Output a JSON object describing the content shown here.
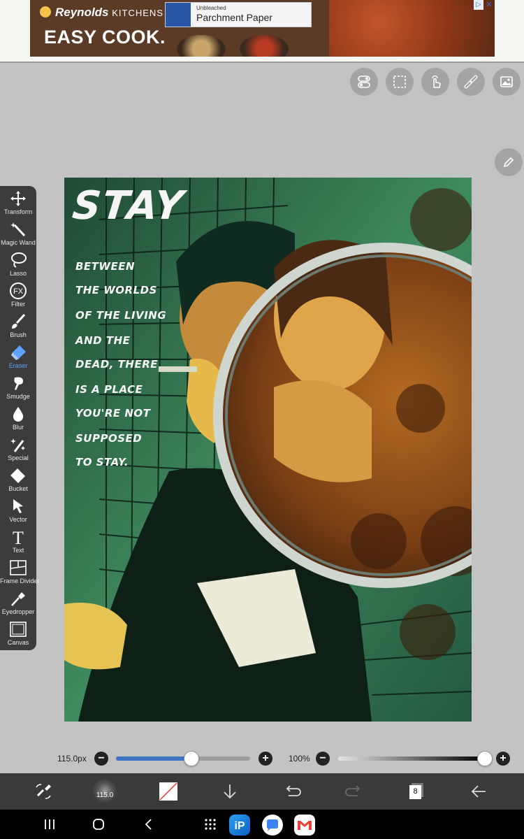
{
  "ad": {
    "brand": "Reynolds",
    "brand_suffix": "KITCHENS",
    "headline": "EASY COOK.",
    "product_sub": "Unbleached",
    "product_name": "Parchment Paper",
    "info_icon": "ad-info-icon",
    "close_icon": "ad-close-icon"
  },
  "top_buttons": [
    "toggle-icon",
    "selection-icon",
    "touch-icon",
    "ruler-icon",
    "image-icon"
  ],
  "side_button": "pen-icon",
  "tools": [
    {
      "label": "Transform",
      "icon": "transform-icon"
    },
    {
      "label": "Magic Wand",
      "icon": "magic-wand-icon"
    },
    {
      "label": "Lasso",
      "icon": "lasso-icon"
    },
    {
      "label": "Filter",
      "icon": "filter-icon"
    },
    {
      "label": "Brush",
      "icon": "brush-icon"
    },
    {
      "label": "Eraser",
      "icon": "eraser-icon",
      "active": true
    },
    {
      "label": "Smudge",
      "icon": "smudge-icon"
    },
    {
      "label": "Blur",
      "icon": "blur-icon"
    },
    {
      "label": "Special",
      "icon": "special-icon"
    },
    {
      "label": "Bucket",
      "icon": "bucket-icon"
    },
    {
      "label": "Vector",
      "icon": "vector-icon"
    },
    {
      "label": "Text",
      "icon": "text-icon"
    },
    {
      "label": "Frame Divider",
      "icon": "frame-divider-icon"
    },
    {
      "label": "Eyedropper",
      "icon": "eyedropper-icon"
    },
    {
      "label": "Canvas",
      "icon": "canvas-icon"
    }
  ],
  "artwork": {
    "title": "STAY",
    "lines": [
      "BETWEEN",
      "THE WORLDS",
      "OF THE LIVING",
      "AND THE",
      "DEAD, THERE",
      "IS A PLACE",
      "YOU'RE NOT",
      "SUPPOSED",
      "TO STAY."
    ]
  },
  "brush_size": {
    "label": "115.0px",
    "value": 115.0,
    "level": 0.56
  },
  "opacity": {
    "label": "100%",
    "level": 1.0
  },
  "bottom_toolbar": {
    "brush_preview_label": "115.0",
    "layers_count": "8"
  },
  "colors": {
    "panel": "#3c3c3c",
    "toolbar": "#3a3a3a",
    "accent": "#5ea2ff",
    "slider_fill": "#3d74c4"
  }
}
